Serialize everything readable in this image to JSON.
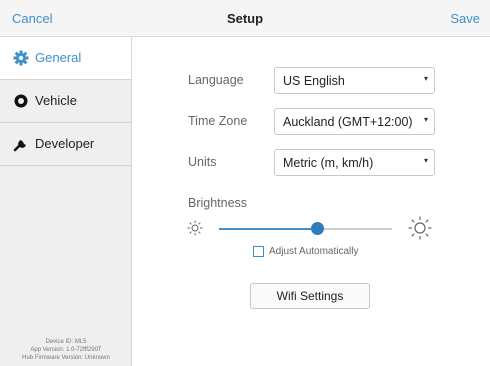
{
  "header": {
    "cancel_label": "Cancel",
    "title": "Setup",
    "save_label": "Save"
  },
  "sidebar": {
    "items": [
      {
        "label": "General",
        "icon": "gear-icon",
        "active": true
      },
      {
        "label": "Vehicle",
        "icon": "vehicle-icon",
        "active": false
      },
      {
        "label": "Developer",
        "icon": "wrench-icon",
        "active": false
      }
    ],
    "device_info": {
      "device_id": "Device ID: ML5",
      "app_version": "App Version: 1.0-72fff290T",
      "hub_firmware": "Hub Firmware Version: Unknown"
    }
  },
  "settings": {
    "language": {
      "label": "Language",
      "value": "US English"
    },
    "timezone": {
      "label": "Time Zone",
      "value": "Auckland (GMT+12:00)"
    },
    "units": {
      "label": "Units",
      "value": "Metric (m, km/h)"
    },
    "brightness": {
      "label": "Brightness",
      "level_percent": 57
    },
    "auto_brightness": {
      "label": "Adjust Automatically",
      "checked": false
    },
    "wifi_button": "Wifi Settings"
  },
  "colors": {
    "accent": "#3f8fca",
    "thumb": "#2e7bbd"
  }
}
